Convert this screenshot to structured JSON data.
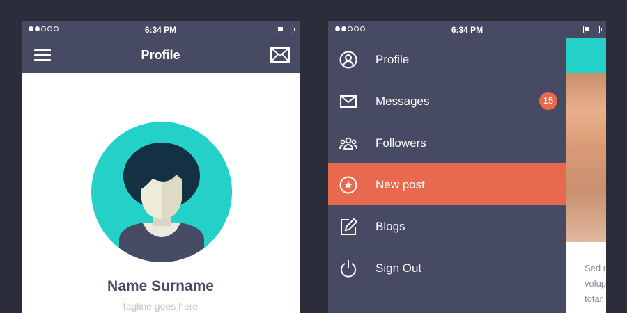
{
  "colors": {
    "background": "#2b2d3a",
    "nav": "#474a63",
    "accent_teal": "#23d1c9",
    "accent_orange": "#e8694d"
  },
  "status_bar": {
    "time": "6:34 PM",
    "signal_filled": 2,
    "signal_total": 5,
    "battery_level": 0.3
  },
  "profile_screen": {
    "title": "Profile",
    "left_icon": "hamburger-menu-icon",
    "right_icon": "envelope-icon",
    "name": "Name Surname",
    "tagline": "tagline goes here"
  },
  "menu_screen": {
    "items": [
      {
        "label": "Profile",
        "icon": "user-circle-icon",
        "active": false
      },
      {
        "label": "Messages",
        "icon": "envelope-icon",
        "active": false,
        "badge": "15"
      },
      {
        "label": "Followers",
        "icon": "people-icon",
        "active": false
      },
      {
        "label": "New post",
        "icon": "star-circle-icon",
        "active": true
      },
      {
        "label": "Blogs",
        "icon": "edit-icon",
        "active": false
      },
      {
        "label": "Sign Out",
        "icon": "power-icon",
        "active": false
      }
    ],
    "peek_text": [
      "Sed u",
      "volup",
      "totar"
    ]
  }
}
